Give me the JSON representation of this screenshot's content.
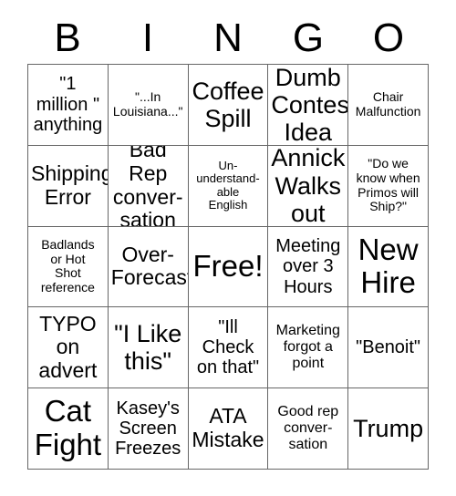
{
  "card": {
    "type": "bingo-card",
    "header": {
      "letters": [
        "B",
        "I",
        "N",
        "G",
        "O"
      ]
    },
    "grid": {
      "rows": 5,
      "columns": 5,
      "free_space_index": 12,
      "cells": [
        {
          "text": "\"1\nmillion \"\nanything",
          "size": "md"
        },
        {
          "text": "\"...In\nLouisiana...\"",
          "size": "xs"
        },
        {
          "text": "Coffee\nSpill",
          "size": "xl"
        },
        {
          "text": "Dumb\nContest\nIdea",
          "size": "xl"
        },
        {
          "text": "Chair\nMalfunction",
          "size": "xs"
        },
        {
          "text": "Shipping\nError",
          "size": "lg"
        },
        {
          "text": "Bad Rep\nconver-\nsation",
          "size": "lg"
        },
        {
          "text": "Un-\nunderstand-\nable\nEnglish",
          "size": "xxs"
        },
        {
          "text": "Annick\nWalks\nout",
          "size": "xl"
        },
        {
          "text": "\"Do we\nknow when\nPrimos will\nShip?\"",
          "size": "xs"
        },
        {
          "text": "Badlands\nor Hot\nShot\nreference",
          "size": "xs"
        },
        {
          "text": "Over-\nForecast",
          "size": "lg"
        },
        {
          "text": "Free!",
          "size": "xxl"
        },
        {
          "text": "Meeting\nover 3\nHours",
          "size": "md"
        },
        {
          "text": "New\nHire",
          "size": "xxl"
        },
        {
          "text": "TYPO\non\nadvert",
          "size": "lg"
        },
        {
          "text": "\"I Like\nthis\"",
          "size": "xl"
        },
        {
          "text": "\"Ill\nCheck\non that\"",
          "size": "md"
        },
        {
          "text": "Marketing\nforgot a\npoint",
          "size": "sm"
        },
        {
          "text": "\"Benoit\"",
          "size": "md"
        },
        {
          "text": "Cat\nFight",
          "size": "xxl"
        },
        {
          "text": "Kasey's\nScreen\nFreezes",
          "size": "md"
        },
        {
          "text": "ATA\nMistake",
          "size": "lg"
        },
        {
          "text": "Good rep\nconver-\nsation",
          "size": "sm"
        },
        {
          "text": "Trump",
          "size": "xl"
        }
      ]
    },
    "colors": {
      "background": "#ffffff",
      "text": "#000000",
      "border": "#666666"
    }
  }
}
